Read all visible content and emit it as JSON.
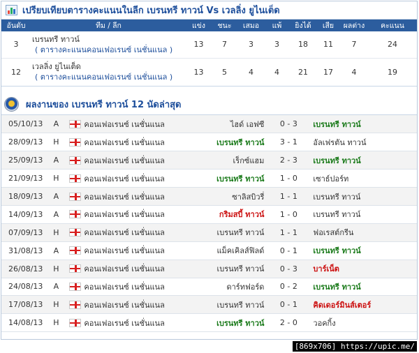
{
  "comparison": {
    "title": "เปรียบเทียบตารางคะแนนในลีก เบรนทรี ทาวน์ Vs เวลลิ่ง ยูไนเต็ด",
    "headers": {
      "rank": "อันดับ",
      "team_league": "ทีม / ลีก",
      "played": "แข่ง",
      "won": "ชนะ",
      "drawn": "เสมอ",
      "lost": "แพ้",
      "goals_for": "ยิงได้",
      "goals_against": "เสีย",
      "diff": "ผลต่าง",
      "points": "คะแนน"
    },
    "rows": [
      {
        "rank": "3",
        "team": "เบรนทรี ทาวน์",
        "league": "( ตารางคะแนนคอนเฟอเรนซ์ เนชั่นแนล )",
        "played": "13",
        "won": "7",
        "drawn": "3",
        "lost": "3",
        "gf": "18",
        "ga": "11",
        "diff": "7",
        "pts": "24"
      },
      {
        "rank": "12",
        "team": "เวลลิ่ง ยูไนเต็ด",
        "league": "( ตารางคะแนนคอนเฟอเรนซ์ เนชั่นแนล )",
        "played": "13",
        "won": "5",
        "drawn": "4",
        "lost": "4",
        "gf": "21",
        "ga": "17",
        "diff": "4",
        "pts": "19"
      }
    ]
  },
  "recent": {
    "title": "ผลงานของ เบรนทรี ทาวน์ 12 นัดล่าสุด",
    "competition": "คอนเฟอเรนซ์ เนชั่นแนล",
    "matches": [
      {
        "date": "05/10/13",
        "ha": "A",
        "home": "ไฮด์ เอฟซี",
        "score": "0 - 3",
        "away": "เบรนทรี ทาวน์",
        "home_style": "plain",
        "away_style": "hl-green"
      },
      {
        "date": "28/09/13",
        "ha": "H",
        "home": "เบรนทรี ทาวน์",
        "score": "3 - 1",
        "away": "อัลเฟรตัน ทาวน์",
        "home_style": "hl-green",
        "away_style": "plain"
      },
      {
        "date": "25/09/13",
        "ha": "A",
        "home": "เร็กซ์แฮม",
        "score": "2 - 3",
        "away": "เบรนทรี ทาวน์",
        "home_style": "plain",
        "away_style": "hl-green"
      },
      {
        "date": "21/09/13",
        "ha": "H",
        "home": "เบรนทรี ทาวน์",
        "score": "1 - 0",
        "away": "เซาธ์ปอร์ท",
        "home_style": "hl-green",
        "away_style": "plain"
      },
      {
        "date": "18/09/13",
        "ha": "A",
        "home": "ซาลิสบิวรี่",
        "score": "1 - 1",
        "away": "เบรนทรี ทาวน์",
        "home_style": "plain",
        "away_style": "plain"
      },
      {
        "date": "14/09/13",
        "ha": "A",
        "home": "กริมสบี้ ทาวน์",
        "score": "1 - 0",
        "away": "เบรนทรี ทาวน์",
        "home_style": "hl-red",
        "away_style": "plain"
      },
      {
        "date": "07/09/13",
        "ha": "H",
        "home": "เบรนทรี ทาวน์",
        "score": "1 - 1",
        "away": "ฟอเรสต์กรีน",
        "home_style": "plain",
        "away_style": "plain"
      },
      {
        "date": "31/08/13",
        "ha": "A",
        "home": "แม็คเคิลส์ฟิลด์",
        "score": "0 - 1",
        "away": "เบรนทรี ทาวน์",
        "home_style": "plain",
        "away_style": "hl-green"
      },
      {
        "date": "26/08/13",
        "ha": "H",
        "home": "เบรนทรี ทาวน์",
        "score": "0 - 3",
        "away": "บาร์เน็ต",
        "home_style": "plain",
        "away_style": "hl-red"
      },
      {
        "date": "24/08/13",
        "ha": "A",
        "home": "ดาร์ทฟอร์ด",
        "score": "0 - 2",
        "away": "เบรนทรี ทาวน์",
        "home_style": "plain",
        "away_style": "hl-green"
      },
      {
        "date": "17/08/13",
        "ha": "H",
        "home": "เบรนทรี ทาวน์",
        "score": "0 - 1",
        "away": "คิดเดอร์มินส์เตอร์",
        "home_style": "plain",
        "away_style": "hl-red"
      },
      {
        "date": "14/08/13",
        "ha": "H",
        "home": "เบรนทรี ทาวน์",
        "score": "2 - 0",
        "away": "วอคกิ้ง",
        "home_style": "hl-green",
        "away_style": "plain"
      }
    ]
  },
  "watermark": "[869x706] https://upic.me/"
}
